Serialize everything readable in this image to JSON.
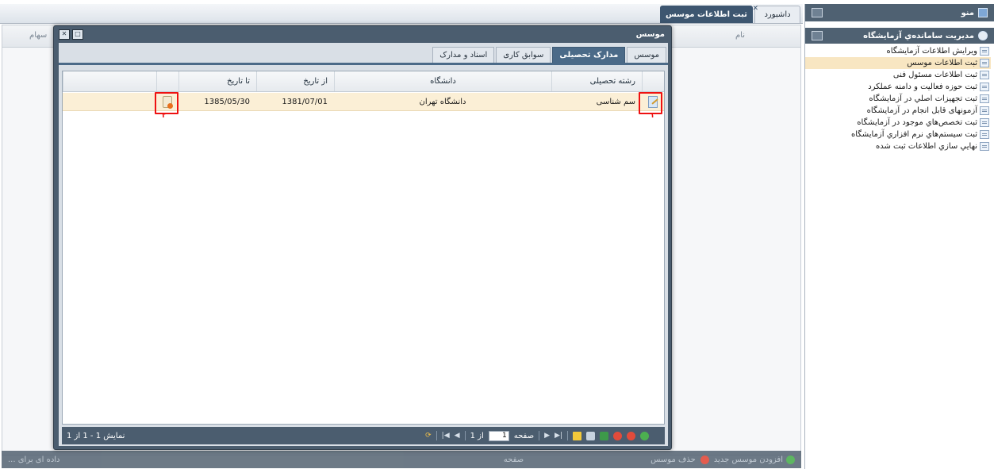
{
  "menu": {
    "title": "منو",
    "section_title": "مديريت سامانده‌ي آزمايشگاه",
    "items": [
      {
        "label": "ویرایش اطلاعات آزمایشگاه",
        "selected": false
      },
      {
        "label": "ثبت اطلاعات موسس",
        "selected": true
      },
      {
        "label": "ثبت اطلاعات مسئول فنی",
        "selected": false
      },
      {
        "label": "ثبت حوزه فعالیت و دامنه عملکرد",
        "selected": false
      },
      {
        "label": "ثبت تجهيزات اصلي در آزمايشگاه",
        "selected": false
      },
      {
        "label": "آزمونهای قابل انجام در آزمایشگاه",
        "selected": false
      },
      {
        "label": "ثبت تخصص‌هاي موجود در آزمايشگاه",
        "selected": false
      },
      {
        "label": "ثبت سيستم‌هاي نرم افزاري آزمايشگاه",
        "selected": false
      },
      {
        "label": "نهايي سازي اطلاعات ثبت شده",
        "selected": false
      }
    ]
  },
  "tabs": {
    "dashboard": "داشبورد",
    "founder_info": "ثبت اطلاعات موسس"
  },
  "background": {
    "col_name": "نام",
    "col_shares": "سهام",
    "bottom_add": "افزودن موسس جدید",
    "bottom_delete": "حذف موسس",
    "bottom_page": "صفحه",
    "bottom_status": "داده ای برای ..."
  },
  "window": {
    "title": "موسس",
    "subtabs": [
      {
        "label": "موسس",
        "active": false
      },
      {
        "label": "مدارک تحصیلی",
        "active": true
      },
      {
        "label": "سوابق کاری",
        "active": false
      },
      {
        "label": "اسناد و مدارک",
        "active": false
      }
    ],
    "columns": {
      "major": "رشته تحصیلی",
      "university": "دانشگاه",
      "from_date": "از تاریخ",
      "to_date": "تا تاریخ"
    },
    "rows": [
      {
        "major": "سم شناسی",
        "university": "دانشگاه تهران",
        "from_date": "1381/07/01",
        "to_date": "1385/05/30"
      }
    ],
    "markers": {
      "edit": "۱",
      "delete": "۲"
    },
    "pager": {
      "page_label": "صفحه",
      "page_value": "1",
      "of_label": "از 1",
      "status": "نمایش 1 - 1 از 1"
    }
  },
  "colors": {
    "header": "#4f6172",
    "accent": "#4b6a88",
    "row_highlight": "#fbefd6",
    "marker": "#e11111"
  }
}
